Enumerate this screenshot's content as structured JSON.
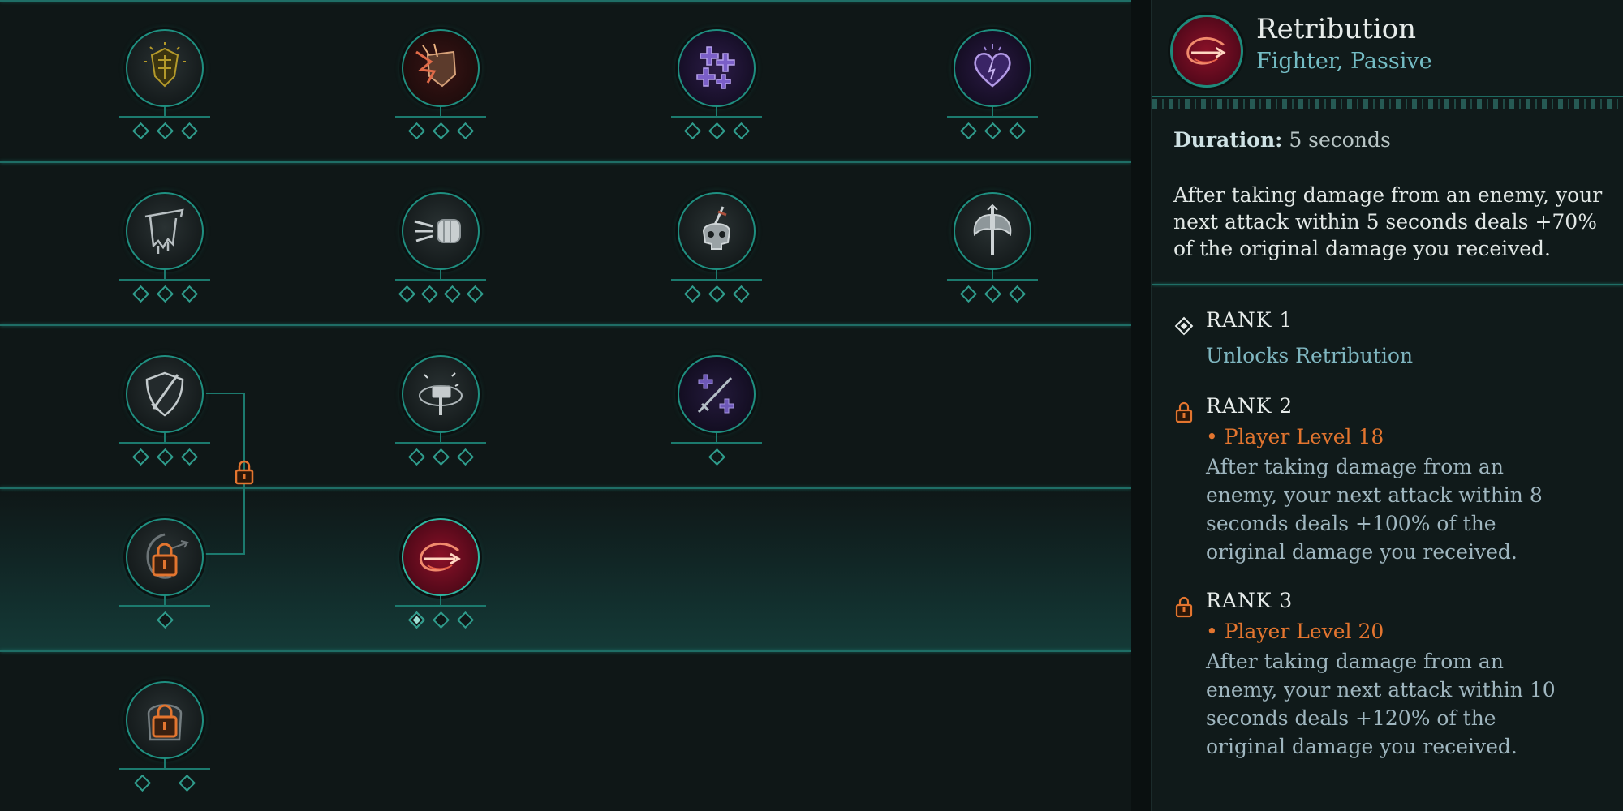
{
  "panel": {
    "title": "Retribution",
    "subtitle": "Fighter, Passive",
    "duration_label": "Duration:",
    "duration_value": "5 seconds",
    "description": "After taking damage from an enemy, your next attack within 5 seconds deals +70% of the original damage you received.",
    "ranks": [
      {
        "label": "RANK 1",
        "unlock": "Unlocks Retribution",
        "icon": "diamond-icon"
      },
      {
        "label": "RANK 2",
        "requirement": "• Player Level 18",
        "text": "After taking damage from an enemy, your next attack within 8 seconds deals +100% of the original damage you received.",
        "icon": "lock-icon"
      },
      {
        "label": "RANK 3",
        "requirement": "• Player Level 20",
        "text": "After taking damage from an enemy, your next attack within 10 seconds deals +120% of the original damage you received.",
        "icon": "lock-icon"
      }
    ]
  },
  "tree": {
    "nodes": [
      {
        "icon": "glowing-shield-icon",
        "pips_total": 3,
        "pips_filled": 0,
        "locked": false
      },
      {
        "icon": "shattered-shield-icon",
        "pips_total": 3,
        "pips_filled": 0,
        "locked": false
      },
      {
        "icon": "purple-crosses-icon",
        "pips_total": 3,
        "pips_filled": 0,
        "locked": false
      },
      {
        "icon": "purple-heart-icon",
        "pips_total": 3,
        "pips_filled": 0,
        "locked": false
      },
      {
        "icon": "torn-banner-icon",
        "pips_total": 3,
        "pips_filled": 0,
        "locked": false
      },
      {
        "icon": "punch-fist-icon",
        "pips_total": 4,
        "pips_filled": 0,
        "locked": false
      },
      {
        "icon": "skull-dagger-icon",
        "pips_total": 3,
        "pips_filled": 0,
        "locked": false
      },
      {
        "icon": "battle-axe-icon",
        "pips_total": 3,
        "pips_filled": 0,
        "locked": false
      },
      {
        "icon": "sword-shield-icon",
        "pips_total": 3,
        "pips_filled": 0,
        "locked": false
      },
      {
        "icon": "spinning-hammer-icon",
        "pips_total": 3,
        "pips_filled": 0,
        "locked": false
      },
      {
        "icon": "crossed-swords-icon",
        "pips_total": 1,
        "pips_filled": 0,
        "locked": false
      },
      {
        "icon": "locked-shield-icon",
        "pips_total": 1,
        "pips_filled": 0,
        "locked": true
      },
      {
        "icon": "retribution-icon",
        "pips_total": 3,
        "pips_filled": 1,
        "locked": false,
        "selected": true
      },
      {
        "icon": "locked-armor-icon",
        "pips_total": 2,
        "pips_filled": 0,
        "locked": true
      }
    ]
  },
  "colors": {
    "accent": "#1f8f80",
    "requirement": "#e3752f",
    "unlock": "#7fb6c0",
    "retribution": "#8a1128"
  }
}
